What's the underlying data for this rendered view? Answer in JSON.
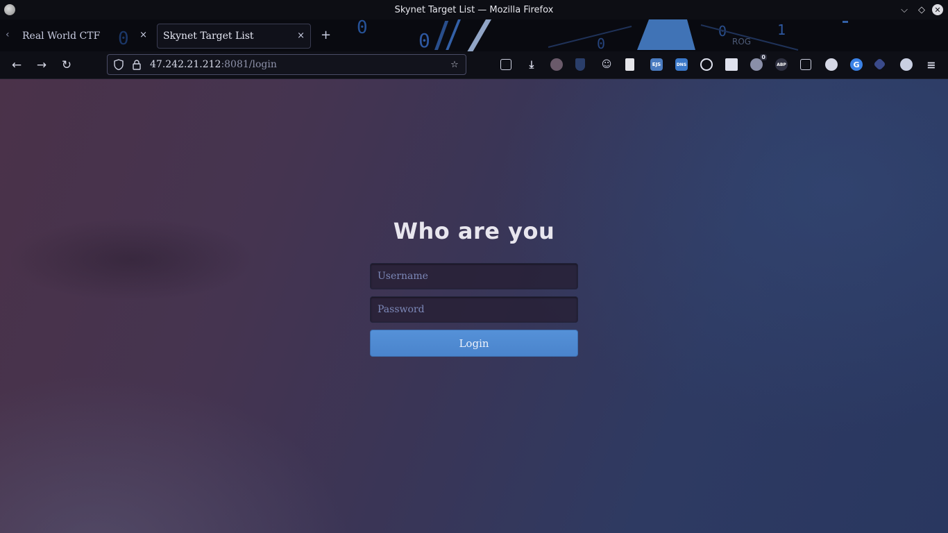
{
  "window": {
    "title": "Skynet Target List — Mozilla Firefox"
  },
  "tabs": [
    {
      "label": "Real World CTF",
      "active": false
    },
    {
      "label": "Skynet Target List",
      "active": true
    }
  ],
  "tab_close_glyph": "×",
  "new_tab_glyph": "+",
  "urlbar": {
    "host": "47.242.21.212",
    "rest": ":8081/login"
  },
  "extensions": [
    {
      "name": "pocket-icon"
    },
    {
      "name": "downloads-icon"
    },
    {
      "name": "ublock-icon"
    },
    {
      "name": "bitwarden-icon"
    },
    {
      "name": "profile-icon"
    },
    {
      "name": "reader-icon"
    },
    {
      "name": "hackbar-icon",
      "label": "EJS"
    },
    {
      "name": "dns-icon",
      "label": "DNS"
    },
    {
      "name": "circle-extension-icon"
    },
    {
      "name": "screenshot-icon"
    },
    {
      "name": "ghostery-icon",
      "badge": "0"
    },
    {
      "name": "adblock-plus-icon",
      "label": "ABP"
    },
    {
      "name": "tab-search-icon"
    },
    {
      "name": "cookie-icon"
    },
    {
      "name": "google-icon"
    },
    {
      "name": "wappalyzer-icon"
    },
    {
      "name": "settings-extension-icon"
    },
    {
      "name": "hamburger-menu-icon"
    }
  ],
  "login": {
    "heading": "Who are you",
    "username_placeholder": "Username",
    "password_placeholder": "Password",
    "button_label": "Login"
  },
  "colors": {
    "accent": "#4a84cc",
    "page_gradient_start": "#4a3249",
    "page_gradient_end": "#293760"
  }
}
